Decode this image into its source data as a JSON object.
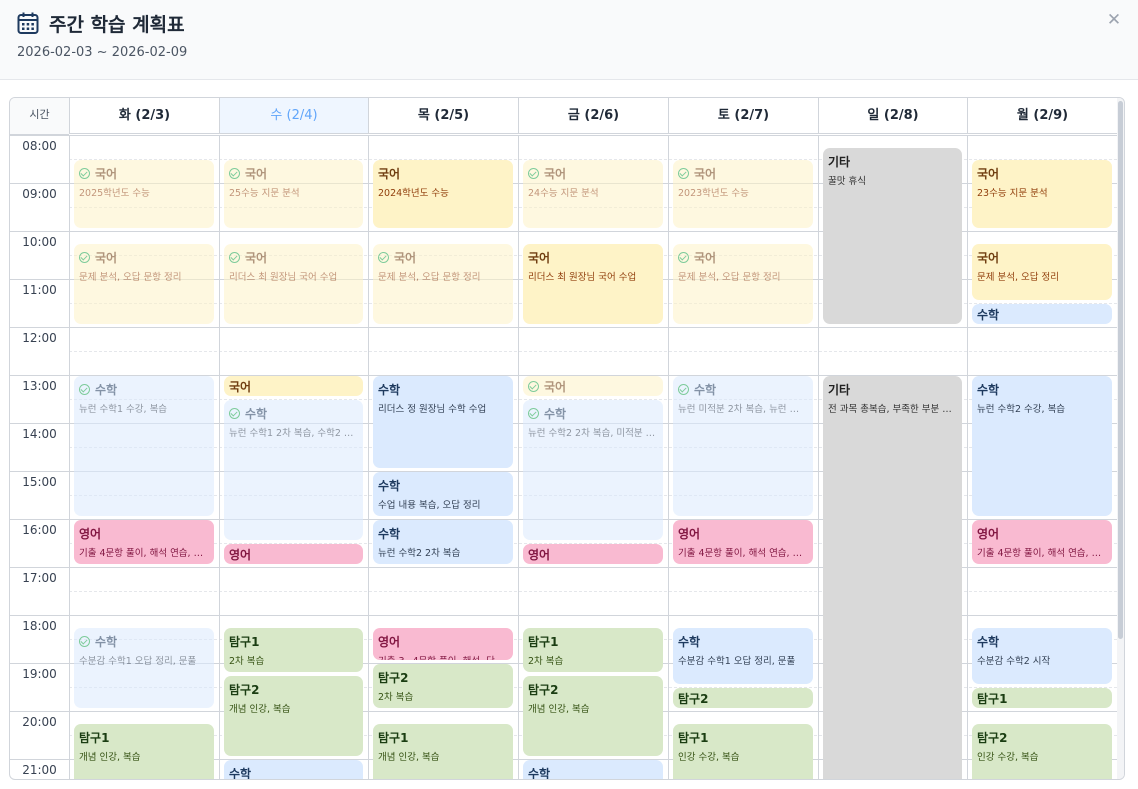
{
  "header": {
    "title": "주간 학습 계획표",
    "date_range": "2026-02-03 ~ 2026-02-09",
    "close_icon": "close-icon",
    "calendar_icon": "calendar-icon"
  },
  "grid": {
    "time_header": "시간",
    "days": [
      "화 (2/3)",
      "수 (2/4)",
      "목 (2/5)",
      "금 (2/6)",
      "토 (2/7)",
      "일 (2/8)",
      "월 (2/9)"
    ],
    "today_index": 1,
    "hours": [
      "08:00",
      "09:00",
      "10:00",
      "11:00",
      "12:00",
      "13:00",
      "14:00",
      "15:00",
      "16:00",
      "17:00",
      "18:00",
      "19:00",
      "20:00",
      "21:00"
    ]
  },
  "colors": {
    "국어": "#fef3c7",
    "수학": "#dbeafe",
    "영어": "#f9bad1",
    "탐구": "#d8e8c8",
    "기타": "#d9d9d9",
    "today": "#eff6ff",
    "check": "#16a34a"
  },
  "events": [
    {
      "day": 0,
      "start": 8.5,
      "end": 10.0,
      "subject": "국어",
      "title": "국어",
      "desc": "2025학년도 수능",
      "done": true,
      "cat": "kor"
    },
    {
      "day": 0,
      "start": 10.25,
      "end": 12.0,
      "subject": "국어",
      "title": "국어",
      "desc": "문제 분석, 오답 문항 정리",
      "done": true,
      "cat": "kor"
    },
    {
      "day": 0,
      "start": 13.0,
      "end": 16.0,
      "subject": "수학",
      "title": "수학",
      "desc": "뉴런 수학1 수강, 복습",
      "done": true,
      "cat": "math"
    },
    {
      "day": 0,
      "start": 16.0,
      "end": 17.0,
      "subject": "영어",
      "title": "영어",
      "desc": "기출 4문항 풀이, 해석 연습, …",
      "done": false,
      "cat": "eng"
    },
    {
      "day": 0,
      "start": 18.25,
      "end": 20.0,
      "subject": "수학",
      "title": "수학",
      "desc": "수분감 수학1 오답 정리, 문풀",
      "done": true,
      "cat": "math"
    },
    {
      "day": 0,
      "start": 20.25,
      "end": 22.0,
      "subject": "탐구",
      "title": "탐구1",
      "desc": "개념 인강, 복습",
      "done": false,
      "cat": "sci"
    },
    {
      "day": 1,
      "start": 8.5,
      "end": 10.0,
      "subject": "국어",
      "title": "국어",
      "desc": "25수능 지문 분석",
      "done": true,
      "cat": "kor"
    },
    {
      "day": 1,
      "start": 10.25,
      "end": 12.0,
      "subject": "국어",
      "title": "국어",
      "desc": "리더스 최 원장님 국어 수업",
      "done": true,
      "cat": "kor"
    },
    {
      "day": 1,
      "start": 13.0,
      "end": 13.5,
      "subject": "국어",
      "title": "국어",
      "desc": "",
      "done": false,
      "cat": "kor"
    },
    {
      "day": 1,
      "start": 13.5,
      "end": 16.5,
      "subject": "수학",
      "title": "수학",
      "desc": "뉴런 수학1 2차 복습, 수학2 …",
      "done": true,
      "cat": "math"
    },
    {
      "day": 1,
      "start": 16.5,
      "end": 17.0,
      "subject": "영어",
      "title": "영어",
      "desc": "",
      "done": false,
      "cat": "eng"
    },
    {
      "day": 1,
      "start": 18.25,
      "end": 19.25,
      "subject": "탐구",
      "title": "탐구1",
      "desc": "2차 복습",
      "done": false,
      "cat": "sci"
    },
    {
      "day": 1,
      "start": 19.25,
      "end": 21.0,
      "subject": "탐구",
      "title": "탐구2",
      "desc": "개념 인강, 복습",
      "done": false,
      "cat": "sci"
    },
    {
      "day": 1,
      "start": 21.0,
      "end": 22.0,
      "subject": "수학",
      "title": "수학",
      "desc": "",
      "done": false,
      "cat": "math"
    },
    {
      "day": 2,
      "start": 8.5,
      "end": 10.0,
      "subject": "국어",
      "title": "국어",
      "desc": "2024학년도 수능",
      "done": false,
      "cat": "kor"
    },
    {
      "day": 2,
      "start": 10.25,
      "end": 12.0,
      "subject": "국어",
      "title": "국어",
      "desc": "문제 분석, 오답 문항 정리",
      "done": true,
      "cat": "kor"
    },
    {
      "day": 2,
      "start": 13.0,
      "end": 15.0,
      "subject": "수학",
      "title": "수학",
      "desc": "리더스 정 원장님 수학 수업",
      "done": false,
      "cat": "math"
    },
    {
      "day": 2,
      "start": 15.0,
      "end": 16.0,
      "subject": "수학",
      "title": "수학",
      "desc": "수업 내용 복습, 오답 정리",
      "done": false,
      "cat": "math"
    },
    {
      "day": 2,
      "start": 16.0,
      "end": 17.0,
      "subject": "수학",
      "title": "수학",
      "desc": "뉴런 수학2 2차 복습",
      "done": false,
      "cat": "math"
    },
    {
      "day": 2,
      "start": 18.25,
      "end": 19.0,
      "subject": "영어",
      "title": "영어",
      "desc": "기출 3~4문항 풀이, 해석, 단…",
      "done": false,
      "cat": "eng"
    },
    {
      "day": 2,
      "start": 19.0,
      "end": 20.0,
      "subject": "탐구",
      "title": "탐구2",
      "desc": "2차 복습",
      "done": false,
      "cat": "sci"
    },
    {
      "day": 2,
      "start": 20.25,
      "end": 22.0,
      "subject": "탐구",
      "title": "탐구1",
      "desc": "개념 인강, 복습",
      "done": false,
      "cat": "sci"
    },
    {
      "day": 3,
      "start": 8.5,
      "end": 10.0,
      "subject": "국어",
      "title": "국어",
      "desc": "24수능 지문 분석",
      "done": true,
      "cat": "kor"
    },
    {
      "day": 3,
      "start": 10.25,
      "end": 12.0,
      "subject": "국어",
      "title": "국어",
      "desc": "리더스 최 원장님 국어 수업",
      "done": false,
      "cat": "kor"
    },
    {
      "day": 3,
      "start": 13.0,
      "end": 13.5,
      "subject": "국어",
      "title": "국어",
      "desc": "",
      "done": true,
      "cat": "kor"
    },
    {
      "day": 3,
      "start": 13.5,
      "end": 16.5,
      "subject": "수학",
      "title": "수학",
      "desc": "뉴런 수학2 2차 복습, 미적분 …",
      "done": true,
      "cat": "math"
    },
    {
      "day": 3,
      "start": 16.5,
      "end": 17.0,
      "subject": "영어",
      "title": "영어",
      "desc": "",
      "done": false,
      "cat": "eng"
    },
    {
      "day": 3,
      "start": 18.25,
      "end": 19.25,
      "subject": "탐구",
      "title": "탐구1",
      "desc": "2차 복습",
      "done": false,
      "cat": "sci"
    },
    {
      "day": 3,
      "start": 19.25,
      "end": 21.0,
      "subject": "탐구",
      "title": "탐구2",
      "desc": "개념 인강, 복습",
      "done": false,
      "cat": "sci"
    },
    {
      "day": 3,
      "start": 21.0,
      "end": 22.0,
      "subject": "수학",
      "title": "수학",
      "desc": "",
      "done": false,
      "cat": "math"
    },
    {
      "day": 4,
      "start": 8.5,
      "end": 10.0,
      "subject": "국어",
      "title": "국어",
      "desc": "2023학년도 수능",
      "done": true,
      "cat": "kor"
    },
    {
      "day": 4,
      "start": 10.25,
      "end": 12.0,
      "subject": "국어",
      "title": "국어",
      "desc": "문제 분석, 오답 문항 정리",
      "done": true,
      "cat": "kor"
    },
    {
      "day": 4,
      "start": 13.0,
      "end": 16.0,
      "subject": "수학",
      "title": "수학",
      "desc": "뉴런 미적분 2차 복습, 뉴런 …",
      "done": true,
      "cat": "math"
    },
    {
      "day": 4,
      "start": 16.0,
      "end": 17.0,
      "subject": "영어",
      "title": "영어",
      "desc": "기출 4문항 풀이, 해석 연습, …",
      "done": false,
      "cat": "eng"
    },
    {
      "day": 4,
      "start": 18.25,
      "end": 19.5,
      "subject": "수학",
      "title": "수학",
      "desc": "수분감 수학1 오답 정리, 문풀",
      "done": false,
      "cat": "math"
    },
    {
      "day": 4,
      "start": 19.5,
      "end": 20.0,
      "subject": "탐구",
      "title": "탐구2",
      "desc": "",
      "done": false,
      "cat": "sci"
    },
    {
      "day": 4,
      "start": 20.25,
      "end": 22.0,
      "subject": "탐구",
      "title": "탐구1",
      "desc": "인강 수강, 복습",
      "done": false,
      "cat": "sci"
    },
    {
      "day": 5,
      "start": 8.25,
      "end": 12.0,
      "subject": "기타",
      "title": "기타",
      "desc": "꿀맛 휴식",
      "done": false,
      "cat": "etc"
    },
    {
      "day": 5,
      "start": 13.0,
      "end": 22.0,
      "subject": "기타",
      "title": "기타",
      "desc": "전 과목 총복습, 부족한 부분 …",
      "done": false,
      "cat": "etc"
    },
    {
      "day": 6,
      "start": 8.5,
      "end": 10.0,
      "subject": "국어",
      "title": "국어",
      "desc": "23수능 지문 분석",
      "done": false,
      "cat": "kor"
    },
    {
      "day": 6,
      "start": 10.25,
      "end": 11.5,
      "subject": "국어",
      "title": "국어",
      "desc": "문제 분석, 오답 정리",
      "done": false,
      "cat": "kor"
    },
    {
      "day": 6,
      "start": 11.5,
      "end": 12.0,
      "subject": "수학",
      "title": "수학",
      "desc": "",
      "done": false,
      "cat": "math"
    },
    {
      "day": 6,
      "start": 13.0,
      "end": 16.0,
      "subject": "수학",
      "title": "수학",
      "desc": "뉴런 수학2 수강, 복습",
      "done": false,
      "cat": "math"
    },
    {
      "day": 6,
      "start": 16.0,
      "end": 17.0,
      "subject": "영어",
      "title": "영어",
      "desc": "기출 4문항 풀이, 해석 연습, …",
      "done": false,
      "cat": "eng"
    },
    {
      "day": 6,
      "start": 18.25,
      "end": 19.5,
      "subject": "수학",
      "title": "수학",
      "desc": "수분감 수학2 시작",
      "done": false,
      "cat": "math"
    },
    {
      "day": 6,
      "start": 19.5,
      "end": 20.0,
      "subject": "탐구",
      "title": "탐구1",
      "desc": "",
      "done": false,
      "cat": "sci"
    },
    {
      "day": 6,
      "start": 20.25,
      "end": 22.0,
      "subject": "탐구",
      "title": "탐구2",
      "desc": "인강 수강, 복습",
      "done": false,
      "cat": "sci"
    }
  ]
}
